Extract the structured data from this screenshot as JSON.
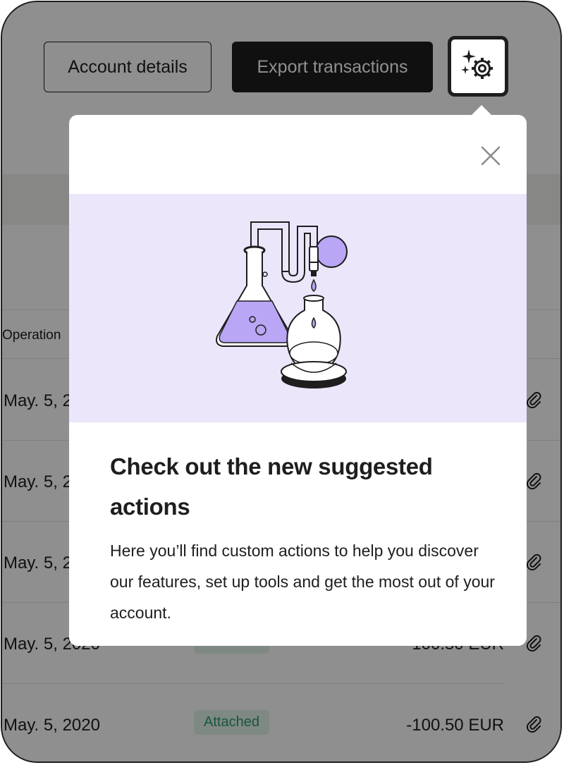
{
  "header": {
    "account_details_label": "Account details",
    "export_transactions_label": "Export transactions",
    "ai_button_icon": "sparkle-gear-icon"
  },
  "table": {
    "column_operation": "Operation",
    "rows": [
      {
        "date": "May. 5, 2020",
        "status": "",
        "amount": ""
      },
      {
        "date": "May. 5, 2020",
        "status": "",
        "amount": ""
      },
      {
        "date": "May. 5, 2020",
        "status": "",
        "amount": ""
      },
      {
        "date": "May. 5, 2020",
        "status": "Attached",
        "amount": "-100.50 EUR"
      },
      {
        "date": "May. 5, 2020",
        "status": "Attached",
        "amount": "-100.50 EUR"
      }
    ],
    "row_icon": "paperclip-icon"
  },
  "popover": {
    "title": "Check out the new suggested actions",
    "description": "Here you’ll find custom actions to help you discover our features, set up tools and get the most out of your account.",
    "close_icon": "close-icon",
    "illustration": "lab-flask-illustration"
  },
  "colors": {
    "ink": "#1e1e1e",
    "illustration_bg": "#ece6fb",
    "accent_purple": "#b9a6f5",
    "badge_green": "#2f9a6c"
  }
}
